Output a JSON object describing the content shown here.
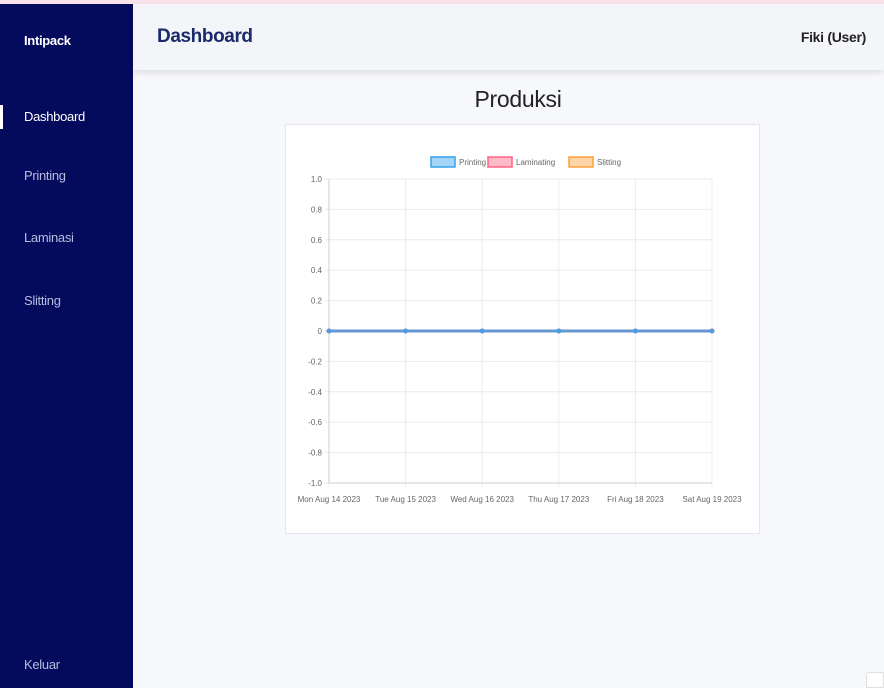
{
  "sidebar": {
    "brand": "Intipack",
    "items": [
      {
        "label": "Dashboard",
        "active": true
      },
      {
        "label": "Printing",
        "active": false
      },
      {
        "label": "Laminasi",
        "active": false
      },
      {
        "label": "Slitting",
        "active": false
      }
    ],
    "logout": "Keluar"
  },
  "header": {
    "title": "Dashboard",
    "user": "Fiki (User)"
  },
  "main": {
    "title": "Produksi"
  },
  "colors": {
    "sidebar_bg": "#050b5c",
    "header_title": "#1b2a6b"
  },
  "chart_data": {
    "type": "line",
    "x": [
      "Mon Aug 14 2023",
      "Tue Aug 15 2023",
      "Wed Aug 16 2023",
      "Thu Aug 17 2023",
      "Fri Aug 18 2023",
      "Sat Aug 19 2023"
    ],
    "series": [
      {
        "name": "Printing",
        "values": [
          0,
          0,
          0,
          0,
          0,
          0
        ],
        "color": "#36a2eb"
      },
      {
        "name": "Laminating",
        "values": [
          0,
          0,
          0,
          0,
          0,
          0
        ],
        "color": "#ff6384"
      },
      {
        "name": "Slitting",
        "values": [
          0,
          0,
          0,
          0,
          0,
          0
        ],
        "color": "#ff9f40"
      }
    ],
    "yticks": [
      "1.0",
      "0.8",
      "0.6",
      "0.4",
      "0.2",
      "0",
      "-0.2",
      "-0.4",
      "-0.6",
      "-0.8",
      "-1.0"
    ],
    "ylim": [
      -1,
      1
    ],
    "grid": true,
    "legend_position": "top"
  }
}
